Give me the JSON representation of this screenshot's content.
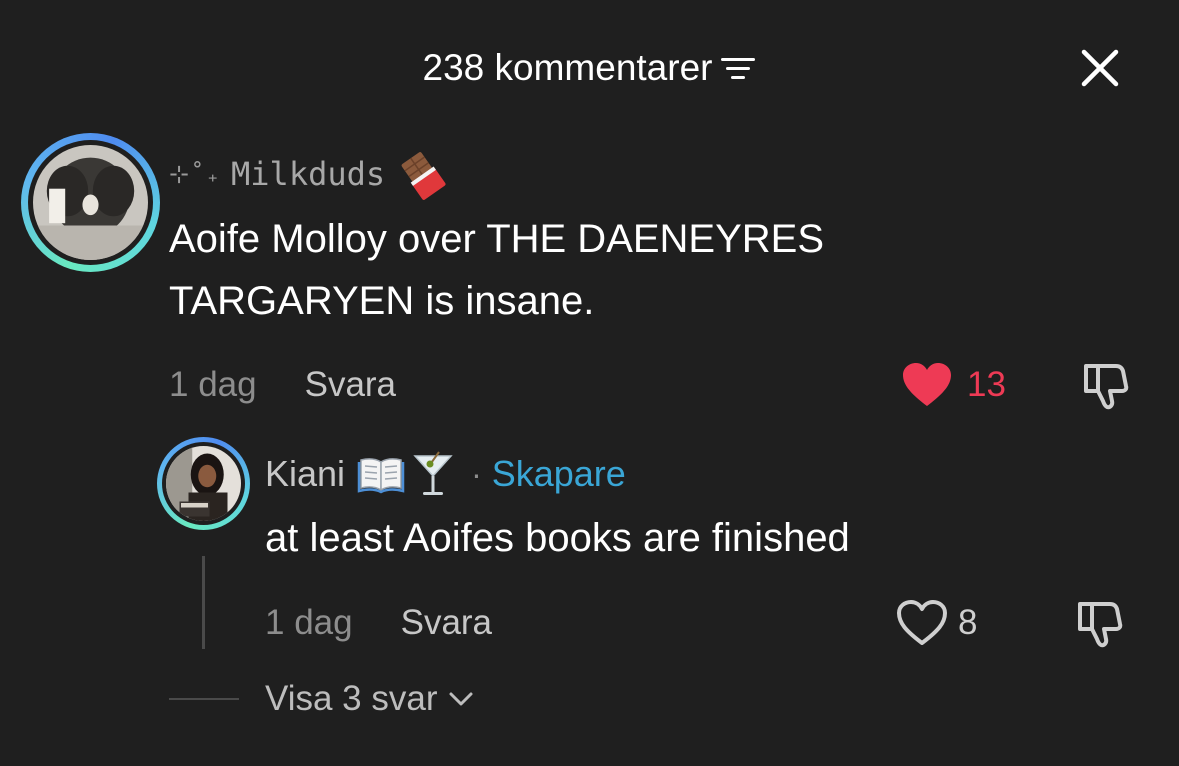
{
  "header": {
    "title": "238 kommentarer"
  },
  "comment": {
    "username_deco": "⊹˚₊",
    "username": "Milkduds",
    "text": "Aoife Molloy over THE DAENEYRES TARGARYEN is insane.",
    "time": "1 dag",
    "reply_label": "Svara",
    "like_count": "13",
    "liked": true,
    "like_color": "#ee3a55"
  },
  "reply": {
    "username": "Kiani",
    "separator": "·",
    "badge": "Skapare",
    "badge_color": "#3aa6d6",
    "text": "at least Aoifes books are finished",
    "time": "1 dag",
    "reply_label": "Svara",
    "like_count": "8",
    "liked": false
  },
  "show_replies": {
    "label": "Visa 3 svar"
  },
  "icons": [
    "sort-icon",
    "close-icon",
    "chocolate-icon",
    "heart-icon",
    "dislike-icon",
    "book-icon",
    "cocktail-icon",
    "chevron-down-icon"
  ],
  "colors": {
    "background": "#1f1f1f",
    "avatar_ring": "#5fb6f0"
  }
}
